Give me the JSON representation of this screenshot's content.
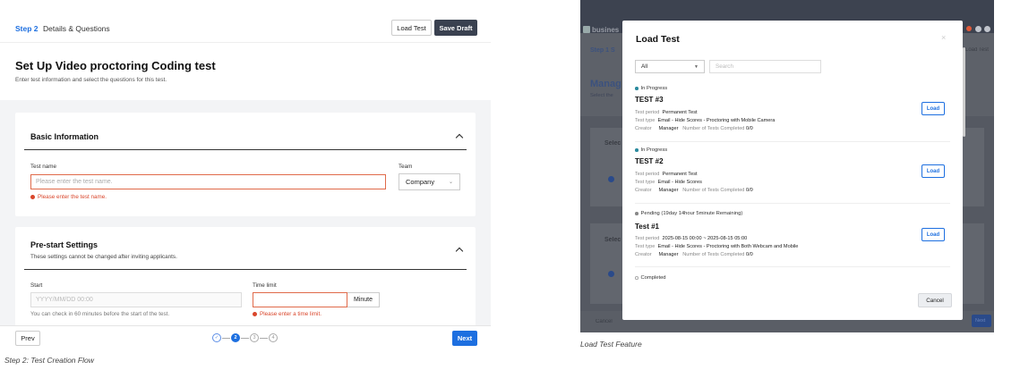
{
  "left": {
    "step_label": "Step 2",
    "step_title": "Details & Questions",
    "load_test_label": "Load Test",
    "save_draft_label": "Save Draft",
    "page_title": "Set Up Video proctoring Coding test",
    "page_subtitle": "Enter test information and select the questions for this test.",
    "basic_info": {
      "title": "Basic Information",
      "test_name_label": "Test name",
      "test_name_placeholder": "Please enter the test name.",
      "test_name_error": "Please enter the test name.",
      "team_label": "Team",
      "team_value": "Company"
    },
    "prestart": {
      "title": "Pre-start Settings",
      "desc": "These settings cannot be changed after inviting applicants.",
      "start_label": "Start",
      "start_placeholder": "YYYY/MM/DD 00:00",
      "start_hint": "You can check in 60 minutes before the start of the test.",
      "time_limit_label": "Time limit",
      "time_unit": "Minute",
      "time_error": "Please enter a time limit."
    },
    "prev_label": "Prev",
    "next_label": "Next",
    "steps": [
      "✓",
      "2",
      "3",
      "4"
    ],
    "caption": "Step 2: Test Creation Flow"
  },
  "right": {
    "bg": {
      "logo": "busines",
      "step_frag": "Step 1  S",
      "load_test_frag": "Load Test",
      "heading_frag": "Manag",
      "sub_frag": "Select the",
      "sel1": "Selec",
      "sel2": "Selec",
      "cancel_frag": "Cancel",
      "next_frag": "Next"
    },
    "modal": {
      "title": "Load Test",
      "close": "×",
      "filter_value": "All",
      "search_placeholder": "Search",
      "labels": {
        "period": "Test period",
        "type": "Test type",
        "creator": "Creator",
        "completed": "Number of Tests Completed"
      },
      "entries": [
        {
          "status": "In Progress",
          "name": "TEST #3",
          "period": "Permanent Test",
          "type": "Email - Hide Scores - Proctoring with Mobile Camera",
          "creator": "Manager",
          "completed": "0/0",
          "load": "Load"
        },
        {
          "status": "In Progress",
          "name": "TEST #2",
          "period": "Permanent Test",
          "type": "Email - Hide Scores",
          "creator": "Manager",
          "completed": "0/0",
          "load": "Load"
        },
        {
          "status": "Pending (19day 14hour 5minute Remaining)",
          "name": "Test #1",
          "period": "2025-08-15 00:00 ~ 2025-08-15 05:00",
          "type": "Email - Hide Scores - Proctoring with Both Webcam and Mobile",
          "creator": "Manager",
          "completed": "0/0",
          "load": "Load"
        }
      ],
      "completed_status": "Completed",
      "cancel_label": "Cancel"
    },
    "caption": "Load Test Feature"
  },
  "colors": {
    "accent": "#1d6fe0",
    "error": "#d9462b",
    "dark_button": "#3a4150",
    "overlay": "#5d6169"
  }
}
